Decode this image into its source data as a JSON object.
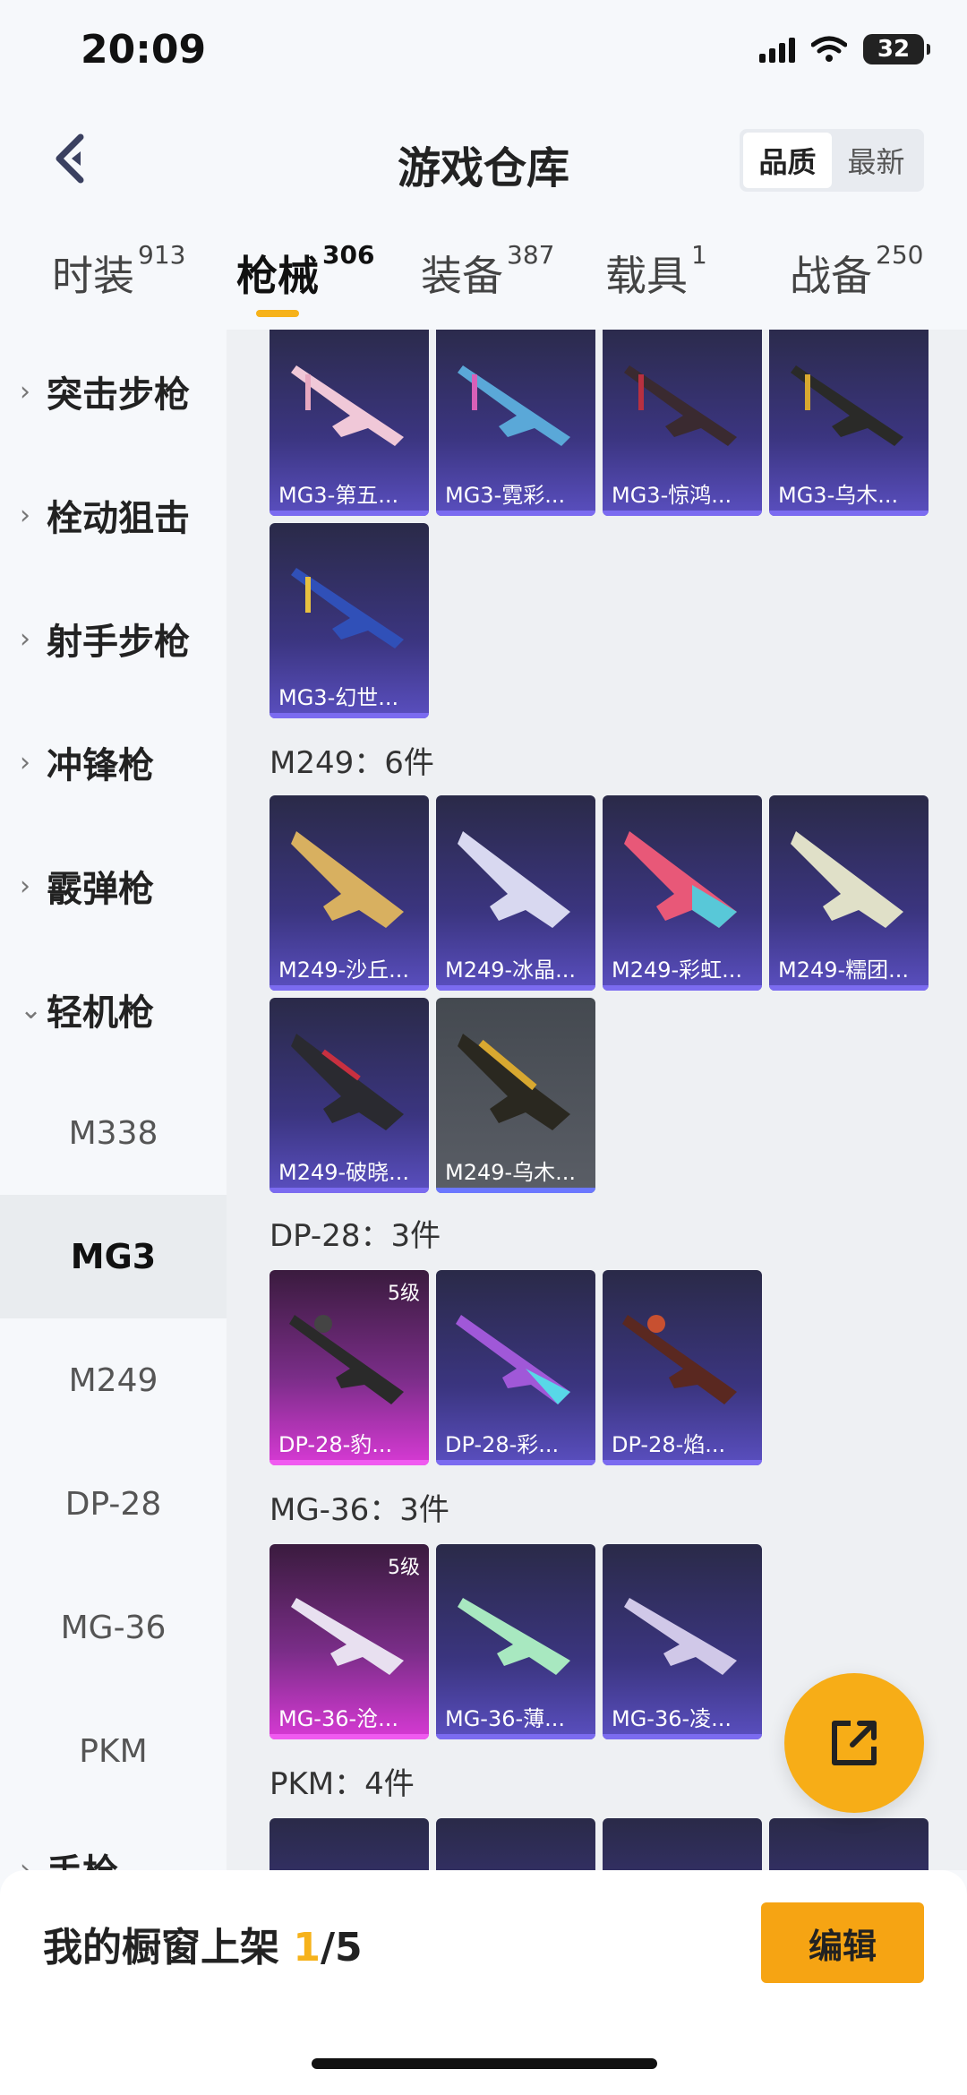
{
  "status": {
    "time": "20:09",
    "battery": "32"
  },
  "nav": {
    "title": "游戏仓库",
    "sort_options": [
      "品质",
      "最新"
    ],
    "active_sort": "品质"
  },
  "categories": [
    {
      "label": "时装",
      "count": "913"
    },
    {
      "label": "枪械",
      "count": "306"
    },
    {
      "label": "装备",
      "count": "387"
    },
    {
      "label": "载具",
      "count": "1"
    },
    {
      "label": "战备",
      "count": "250"
    }
  ],
  "sidebar": {
    "groups": [
      {
        "label": "突击步枪"
      },
      {
        "label": "栓动狙击"
      },
      {
        "label": "射手步枪"
      },
      {
        "label": "冲锋枪"
      },
      {
        "label": "霰弹枪"
      },
      {
        "label": "轻机枪"
      }
    ],
    "subitems": [
      {
        "label": "M338"
      },
      {
        "label": "MG3"
      },
      {
        "label": "M249"
      },
      {
        "label": "DP-28"
      },
      {
        "label": "MG-36"
      },
      {
        "label": "PKM"
      }
    ],
    "partial_next": "手枪"
  },
  "content": {
    "mg3_items": [
      "MG3-第五...",
      "MG3-霓彩...",
      "MG3-惊鸿...",
      "MG3-乌木...",
      "MG3-幻世..."
    ],
    "m249": {
      "title": "M249：6件",
      "items": [
        "M249-沙丘...",
        "M249-冰晶...",
        "M249-彩虹...",
        "M249-糯团...",
        "M249-破晓...",
        "M249-乌木..."
      ]
    },
    "dp28": {
      "title": "DP-28：3件",
      "items": [
        "DP-28-豹...",
        "DP-28-彩...",
        "DP-28-焰..."
      ],
      "level": "5级"
    },
    "mg36": {
      "title": "MG-36：3件",
      "items": [
        "MG-36-沧...",
        "MG-36-薄...",
        "MG-36-凌..."
      ],
      "level": "5级"
    },
    "pkm": {
      "title": "PKM：4件"
    }
  },
  "bottom": {
    "showcase_prefix": "我的橱窗上架 ",
    "showcase_count": "1",
    "showcase_total": "/5",
    "edit_label": "编辑"
  },
  "colors": {
    "accent": "#f6b21a",
    "card_purple": "#3b3580",
    "card_pink": "#d83ad5"
  }
}
